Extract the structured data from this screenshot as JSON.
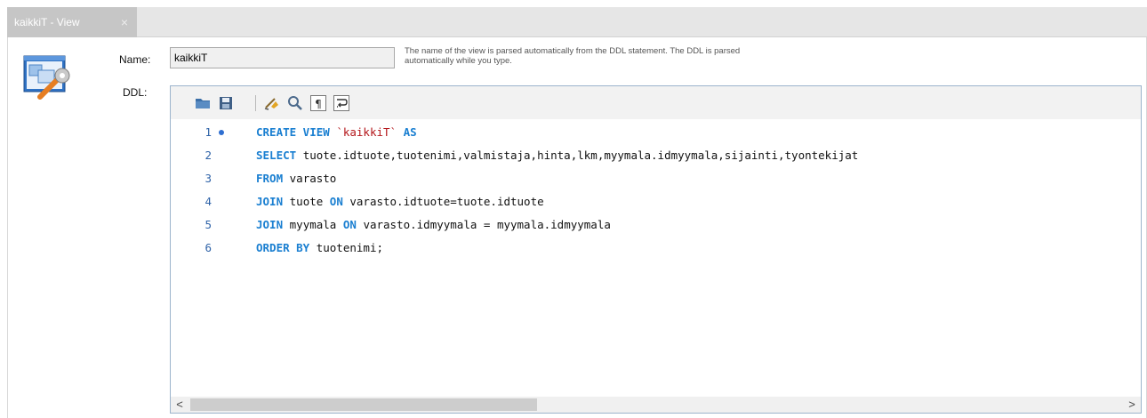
{
  "tab": {
    "title": "kaikkiT - View",
    "close_glyph": "×"
  },
  "form": {
    "name_label": "Name:",
    "name_value": "kaikkiT",
    "hint": "The name of the view is parsed automatically from the DDL statement. The DDL is parsed automatically while you type.",
    "ddl_label": "DDL:"
  },
  "toolbar": {
    "buttons": [
      "open-folder-icon",
      "save-icon",
      "beautify-icon",
      "find-icon",
      "invisible-chars-icon",
      "word-wrap-icon"
    ]
  },
  "code": {
    "lines": [
      {
        "num": "1",
        "marker": true,
        "parts": [
          {
            "t": "CREATE VIEW ",
            "k": "kw"
          },
          {
            "t": "`kaikkiT`",
            "k": "str"
          },
          {
            "t": " AS",
            "k": "kw"
          }
        ]
      },
      {
        "num": "2",
        "marker": false,
        "parts": [
          {
            "t": "SELECT ",
            "k": "kw"
          },
          {
            "t": "tuote.idtuote,tuotenimi,valmistaja,hinta,lkm,myymala.idmyymala,sijainti,tyontekijat",
            "k": ""
          }
        ]
      },
      {
        "num": "3",
        "marker": false,
        "parts": [
          {
            "t": "FROM ",
            "k": "kw"
          },
          {
            "t": "varasto",
            "k": ""
          }
        ]
      },
      {
        "num": "4",
        "marker": false,
        "parts": [
          {
            "t": "JOIN ",
            "k": "kw"
          },
          {
            "t": "tuote ",
            "k": ""
          },
          {
            "t": "ON ",
            "k": "kw"
          },
          {
            "t": "varasto.idtuote=tuote.idtuote",
            "k": ""
          }
        ]
      },
      {
        "num": "5",
        "marker": false,
        "parts": [
          {
            "t": "JOIN ",
            "k": "kw"
          },
          {
            "t": "myymala ",
            "k": ""
          },
          {
            "t": "ON ",
            "k": "kw"
          },
          {
            "t": "varasto.idmyymala = myymala.idmyymala",
            "k": ""
          }
        ]
      },
      {
        "num": "6",
        "marker": false,
        "parts": [
          {
            "t": "ORDER BY ",
            "k": "kw"
          },
          {
            "t": "tuotenimi;",
            "k": ""
          }
        ]
      }
    ]
  },
  "scrollbar": {
    "left_glyph": "<",
    "right_glyph": ">"
  },
  "colors": {
    "keyword": "#1a7fd1",
    "string": "#b4171b",
    "line_number": "#2f63a8",
    "tab_bg": "#c6c6c6"
  }
}
